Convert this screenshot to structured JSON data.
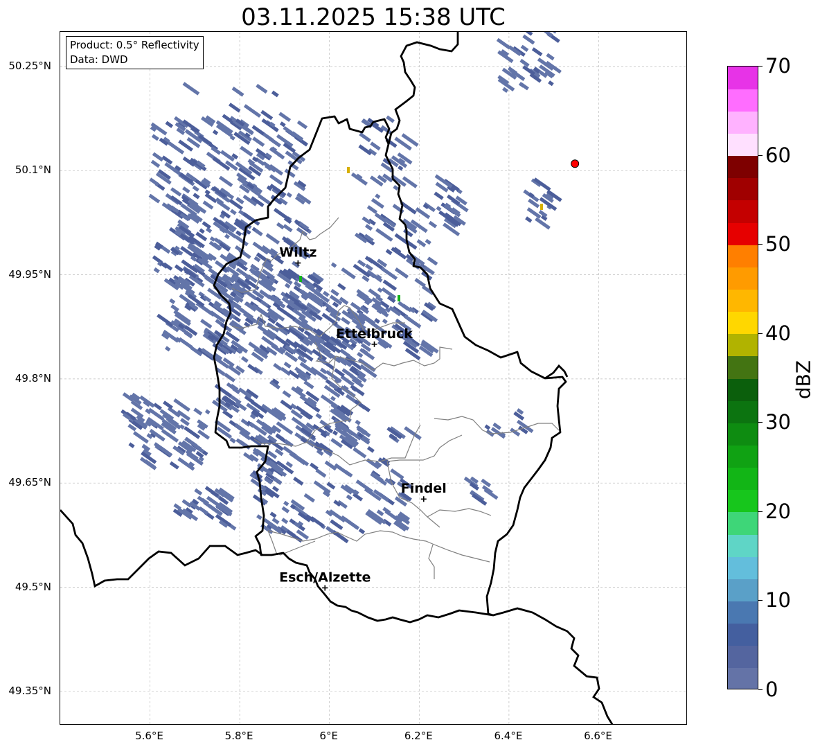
{
  "title": "03.11.2025 15:38 UTC",
  "info": {
    "product": "Product: 0.5° Reflectivity",
    "source": "Data: DWD"
  },
  "lat_labels": [
    "50.25°N",
    "50.1°N",
    "49.95°N",
    "49.8°N",
    "49.65°N",
    "49.5°N",
    "49.35°N"
  ],
  "lon_labels": [
    "5.6°E",
    "5.8°E",
    "6°E",
    "6.2°E",
    "6.4°E",
    "6.6°E"
  ],
  "cities": [
    {
      "name": "Wiltz",
      "lon": 5.93,
      "lat": 49.967
    },
    {
      "name": "Ettelbruck",
      "lon": 6.1,
      "lat": 49.85
    },
    {
      "name": "Findel",
      "lon": 6.21,
      "lat": 49.627
    },
    {
      "name": "Esch/Alzette",
      "lon": 5.99,
      "lat": 49.499
    }
  ],
  "radar_site": {
    "lon": 6.547,
    "lat": 50.11
  },
  "colorbar": {
    "label": "dBZ",
    "min": 0,
    "max": 70,
    "ticks": [
      "0",
      "10",
      "20",
      "30",
      "40",
      "50",
      "60",
      "70"
    ],
    "colors": [
      "#6473a7",
      "#54659f",
      "#445f9f",
      "#4a78b1",
      "#5aa0c8",
      "#63bedc",
      "#5fd5c6",
      "#3ed678",
      "#17c61c",
      "#12b516",
      "#10a213",
      "#0e8c11",
      "#0c7410",
      "#0b5f0c",
      "#437412",
      "#b1b300",
      "#ffd700",
      "#ffb700",
      "#ff9b00",
      "#ff7f00",
      "#e60000",
      "#c40000",
      "#a00000",
      "#7e0000",
      "#ffe0ff",
      "#ffb2ff",
      "#ff6dff",
      "#e733e7"
    ]
  },
  "colors": {
    "echo_main": "#6375a9",
    "echo_dark": "#4c5e9a",
    "echo_green": "#14b31a",
    "echo_yellow": "#d7b000",
    "border": "#000000",
    "canton": "#808080",
    "grid": "#bbbbbb",
    "radar_site": "#ff0000"
  }
}
